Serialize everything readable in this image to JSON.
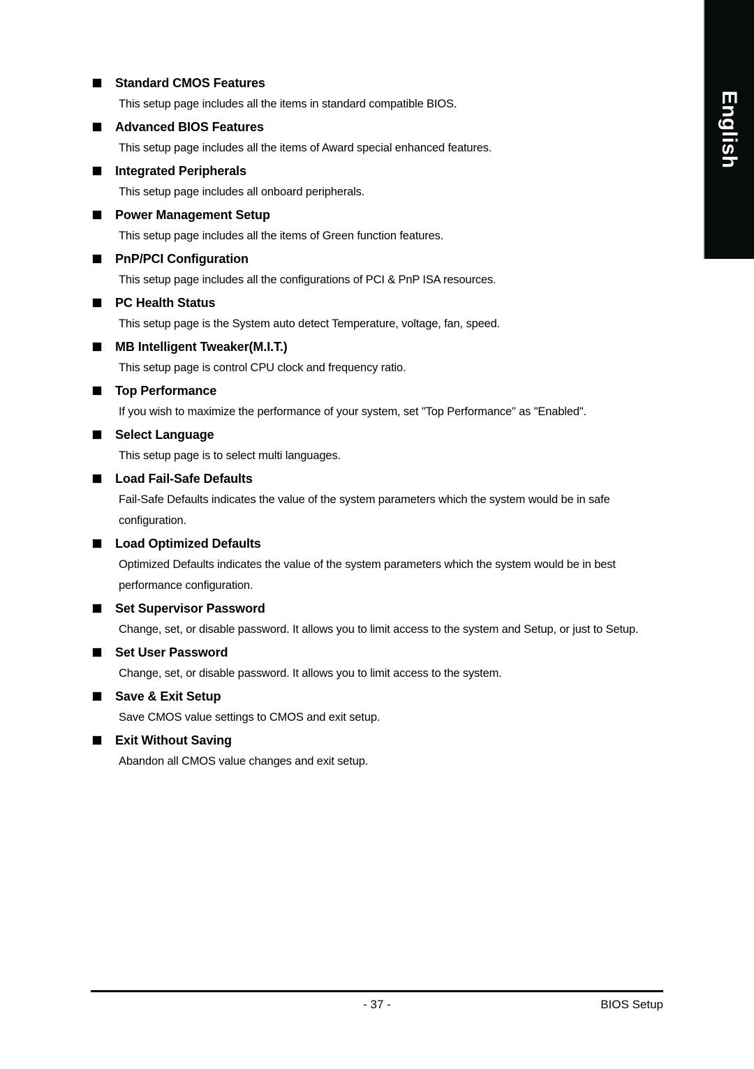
{
  "page": {
    "language_tab": "English",
    "bullet_icon": "filled-square-bullet"
  },
  "sections": [
    {
      "heading": "Standard CMOS Features",
      "body": "This setup page includes all the items in standard compatible BIOS."
    },
    {
      "heading": "Advanced BIOS Features",
      "body": "This setup page includes all the items of Award special enhanced features."
    },
    {
      "heading": "Integrated Peripherals",
      "body": "This setup page includes all onboard peripherals."
    },
    {
      "heading": "Power Management Setup",
      "body": "This setup page includes all the items of Green function features."
    },
    {
      "heading": "PnP/PCI Configuration",
      "body": "This setup page includes all the configurations of PCI & PnP ISA resources."
    },
    {
      "heading": "PC Health Status",
      "body": "This setup page is the System auto detect Temperature, voltage, fan, speed."
    },
    {
      "heading": "MB Intelligent Tweaker(M.I.T.)",
      "body": "This setup page is control CPU clock and frequency ratio."
    },
    {
      "heading": "Top Performance",
      "body": "If you wish to maximize the performance of your system, set \"Top Performance\" as \"Enabled\"."
    },
    {
      "heading": "Select Language",
      "body": "This setup page is to select multi languages."
    },
    {
      "heading": "Load Fail-Safe Defaults",
      "body": "Fail-Safe Defaults indicates the value of the system parameters which the system would be in safe configuration."
    },
    {
      "heading": "Load Optimized Defaults",
      "body": "Optimized Defaults indicates the value of the system parameters which the system would be in best performance configuration."
    },
    {
      "heading": "Set Supervisor Password",
      "body": "Change, set, or disable password. It allows you to limit access to the system and Setup, or just to Setup."
    },
    {
      "heading": "Set User Password",
      "body": "Change, set, or disable password. It allows you to limit access to the system."
    },
    {
      "heading": "Save & Exit Setup",
      "body": "Save CMOS value settings to CMOS and exit setup."
    },
    {
      "heading": "Exit Without Saving",
      "body": "Abandon all CMOS value changes and exit setup."
    }
  ],
  "footer": {
    "page_number": "- 37 -",
    "chapter_label": "BIOS Setup"
  }
}
